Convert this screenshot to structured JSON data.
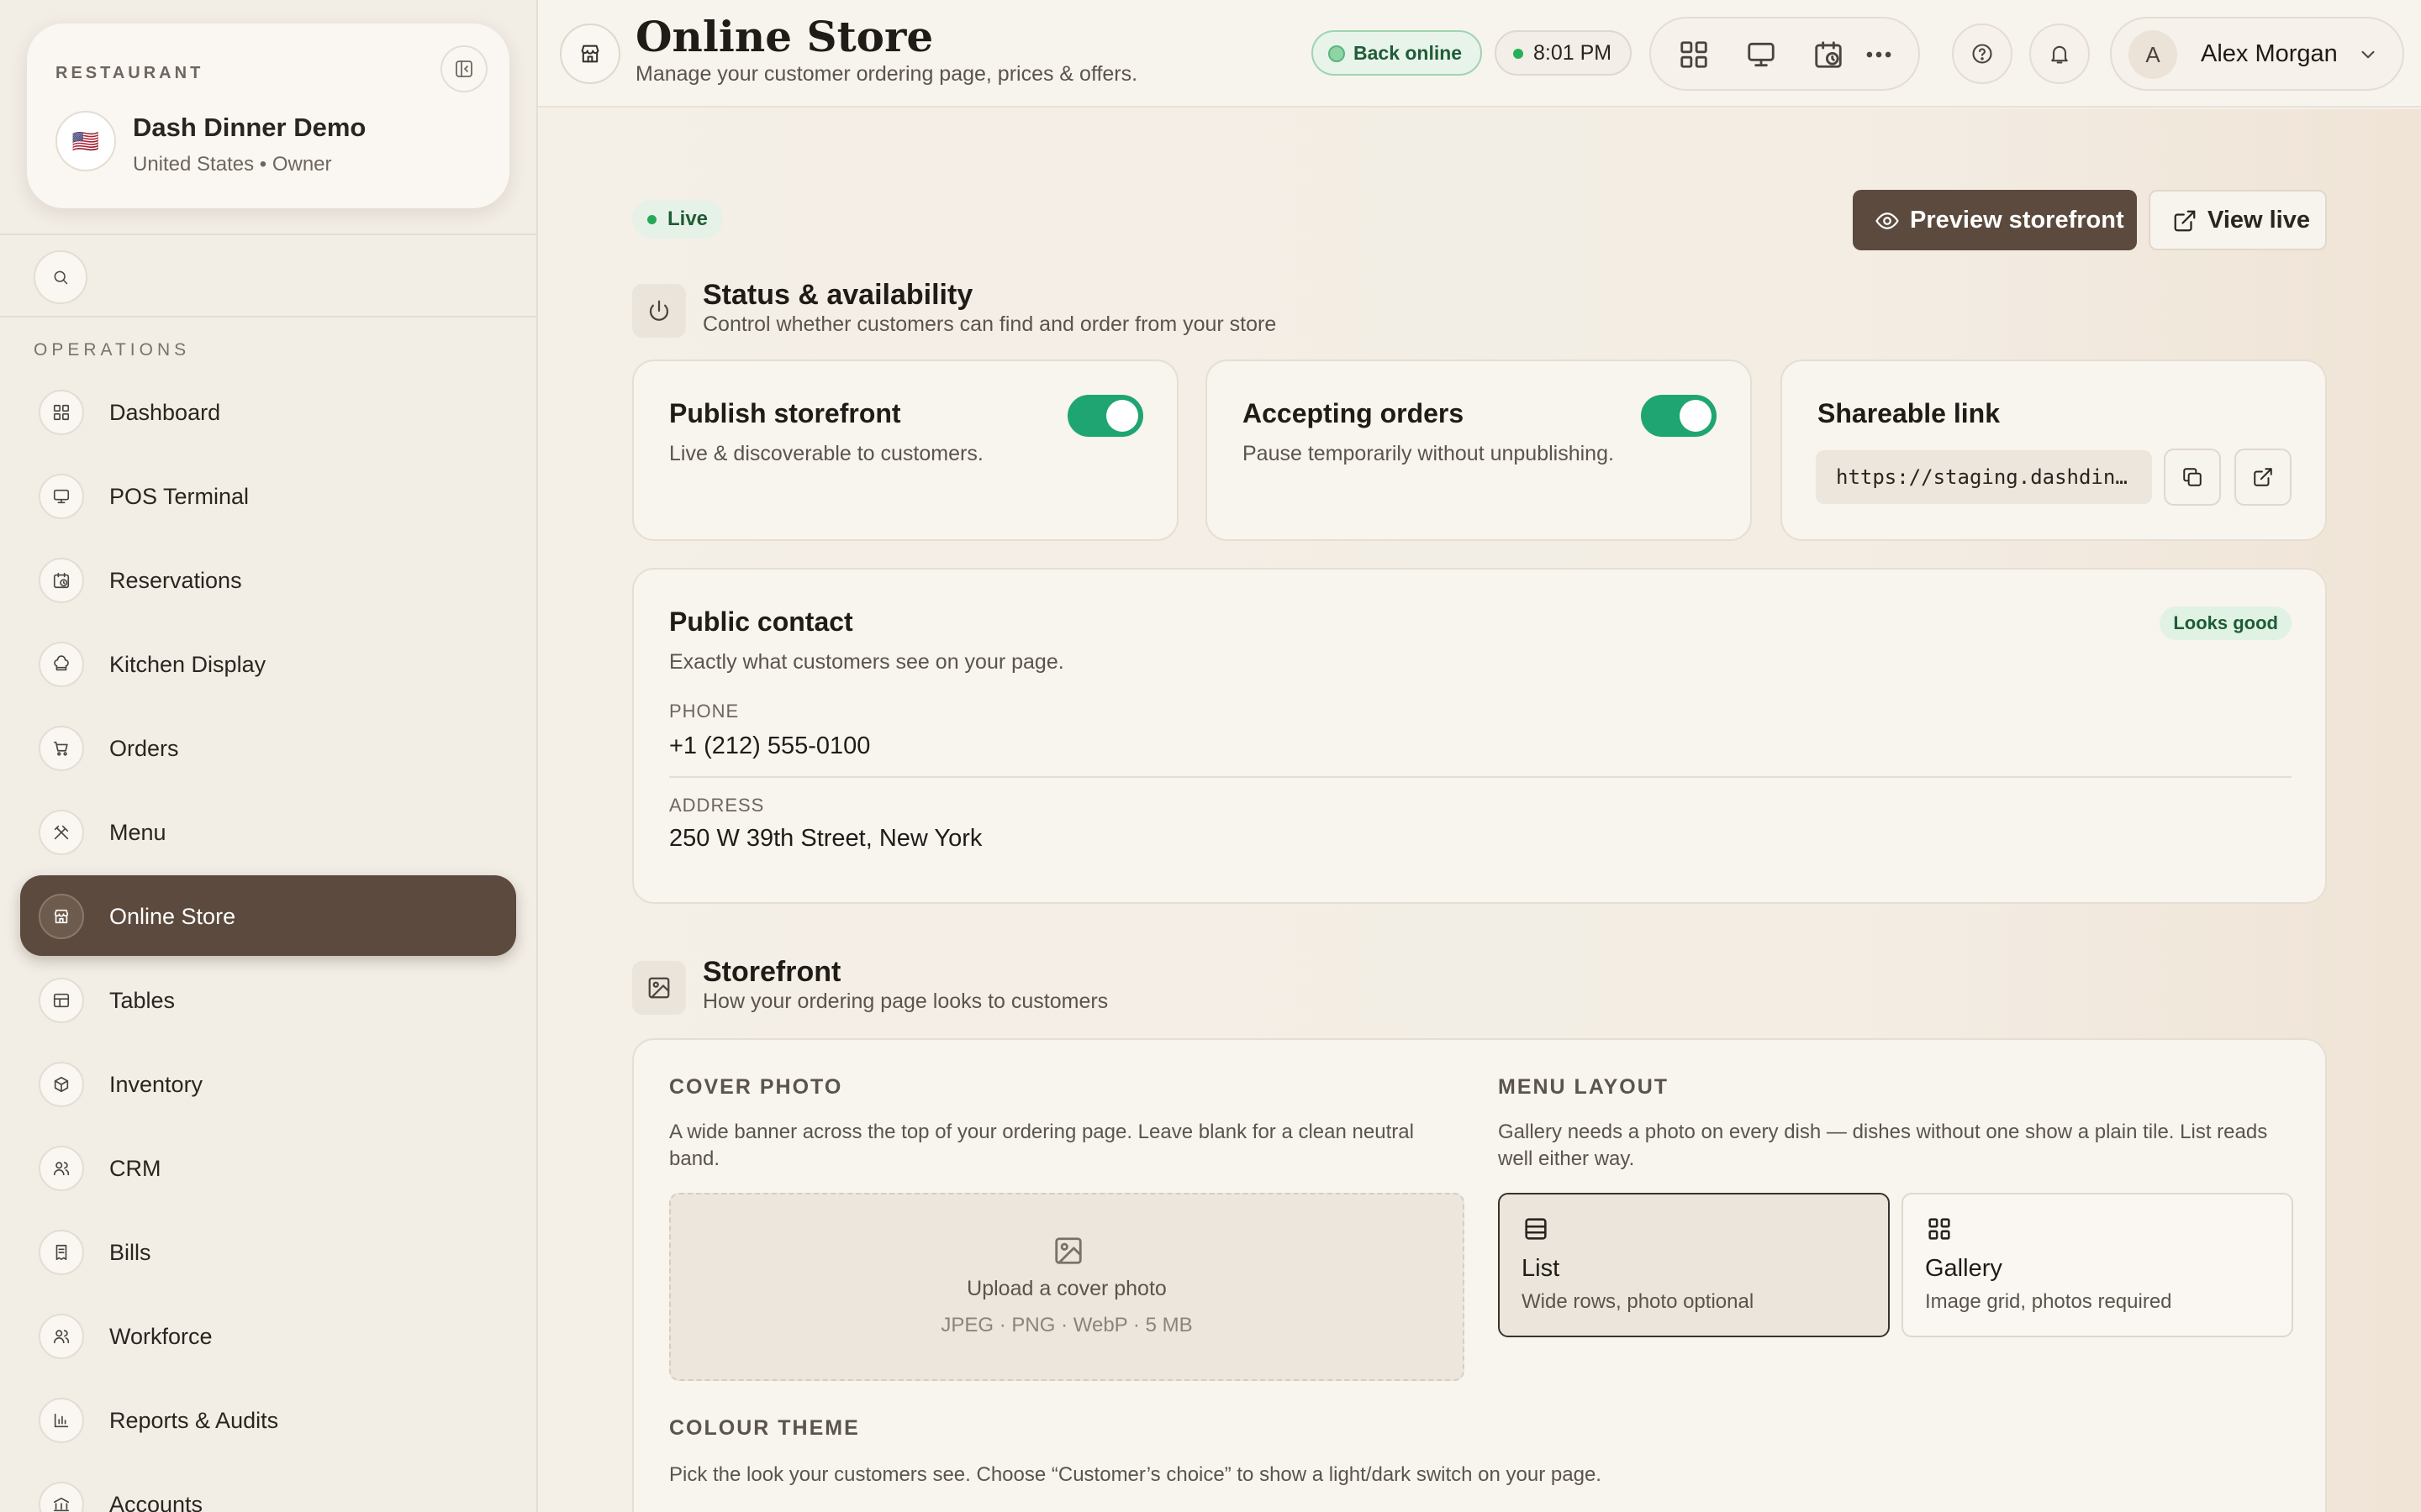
{
  "sidebar": {
    "restaurant_label": "RESTAURANT",
    "flag": "🇺🇸",
    "restaurant_name": "Dash Dinner Demo",
    "restaurant_sub": "United States • Owner",
    "section_label": "OPERATIONS",
    "items": [
      {
        "label": "Dashboard",
        "icon": "grid-icon"
      },
      {
        "label": "POS Terminal",
        "icon": "monitor-icon"
      },
      {
        "label": "Reservations",
        "icon": "calendar-clock-icon"
      },
      {
        "label": "Kitchen Display",
        "icon": "chef-hat-icon"
      },
      {
        "label": "Orders",
        "icon": "cart-icon"
      },
      {
        "label": "Menu",
        "icon": "utensils-icon"
      },
      {
        "label": "Online Store",
        "icon": "store-icon",
        "active": true
      },
      {
        "label": "Tables",
        "icon": "table-icon"
      },
      {
        "label": "Inventory",
        "icon": "box-icon"
      },
      {
        "label": "CRM",
        "icon": "users-icon"
      },
      {
        "label": "Bills",
        "icon": "receipt-icon"
      },
      {
        "label": "Workforce",
        "icon": "users-icon"
      },
      {
        "label": "Reports & Audits",
        "icon": "bar-chart-icon"
      },
      {
        "label": "Accounts",
        "icon": "bank-icon"
      }
    ]
  },
  "header": {
    "title": "Online Store",
    "subtitle": "Manage your customer ordering page, prices & offers.",
    "status_pill": "Back online",
    "time": "8:01 PM",
    "user_initial": "A",
    "user_name": "Alex Morgan"
  },
  "main": {
    "live_badge": "Live",
    "preview_button": "Preview storefront",
    "view_live_button": "View live",
    "status_section": {
      "title": "Status & availability",
      "subtitle": "Control whether customers can find and order from your store"
    },
    "publish": {
      "title": "Publish storefront",
      "desc": "Live & discoverable to customers.",
      "enabled": true
    },
    "accepting": {
      "title": "Accepting orders",
      "desc": "Pause temporarily without unpublishing.",
      "enabled": true
    },
    "shareable": {
      "title": "Shareable link",
      "url": "https://staging.dashdin…"
    },
    "contact": {
      "title": "Public contact",
      "subtitle": "Exactly what customers see on your page.",
      "badge": "Looks good",
      "phone_label": "PHONE",
      "phone": "+1 (212) 555-0100",
      "address_label": "ADDRESS",
      "address": "250 W 39th Street, New York"
    },
    "storefront_section": {
      "title": "Storefront",
      "subtitle": "How your ordering page looks to customers"
    },
    "cover": {
      "label": "COVER PHOTO",
      "desc": "A wide banner across the top of your ordering page. Leave blank for a clean neutral band.",
      "upload_text": "Upload a cover photo",
      "formats": "JPEG · PNG · WebP · 5 MB"
    },
    "menu_layout": {
      "label": "MENU LAYOUT",
      "desc": "Gallery needs a photo on every dish — dishes without one show a plain tile. List reads well either way.",
      "options": [
        {
          "title": "List",
          "desc": "Wide rows, photo optional",
          "selected": true
        },
        {
          "title": "Gallery",
          "desc": "Image grid, photos required",
          "selected": false
        }
      ]
    },
    "colour_theme": {
      "label": "COLOUR THEME",
      "desc": "Pick the look your customers see. Choose “Customer’s choice” to show a light/dark switch on your page."
    }
  },
  "colors": {
    "accent_brown": "#5b4a3d",
    "toggle_green": "#1fa572",
    "background": "#f4efe7"
  }
}
